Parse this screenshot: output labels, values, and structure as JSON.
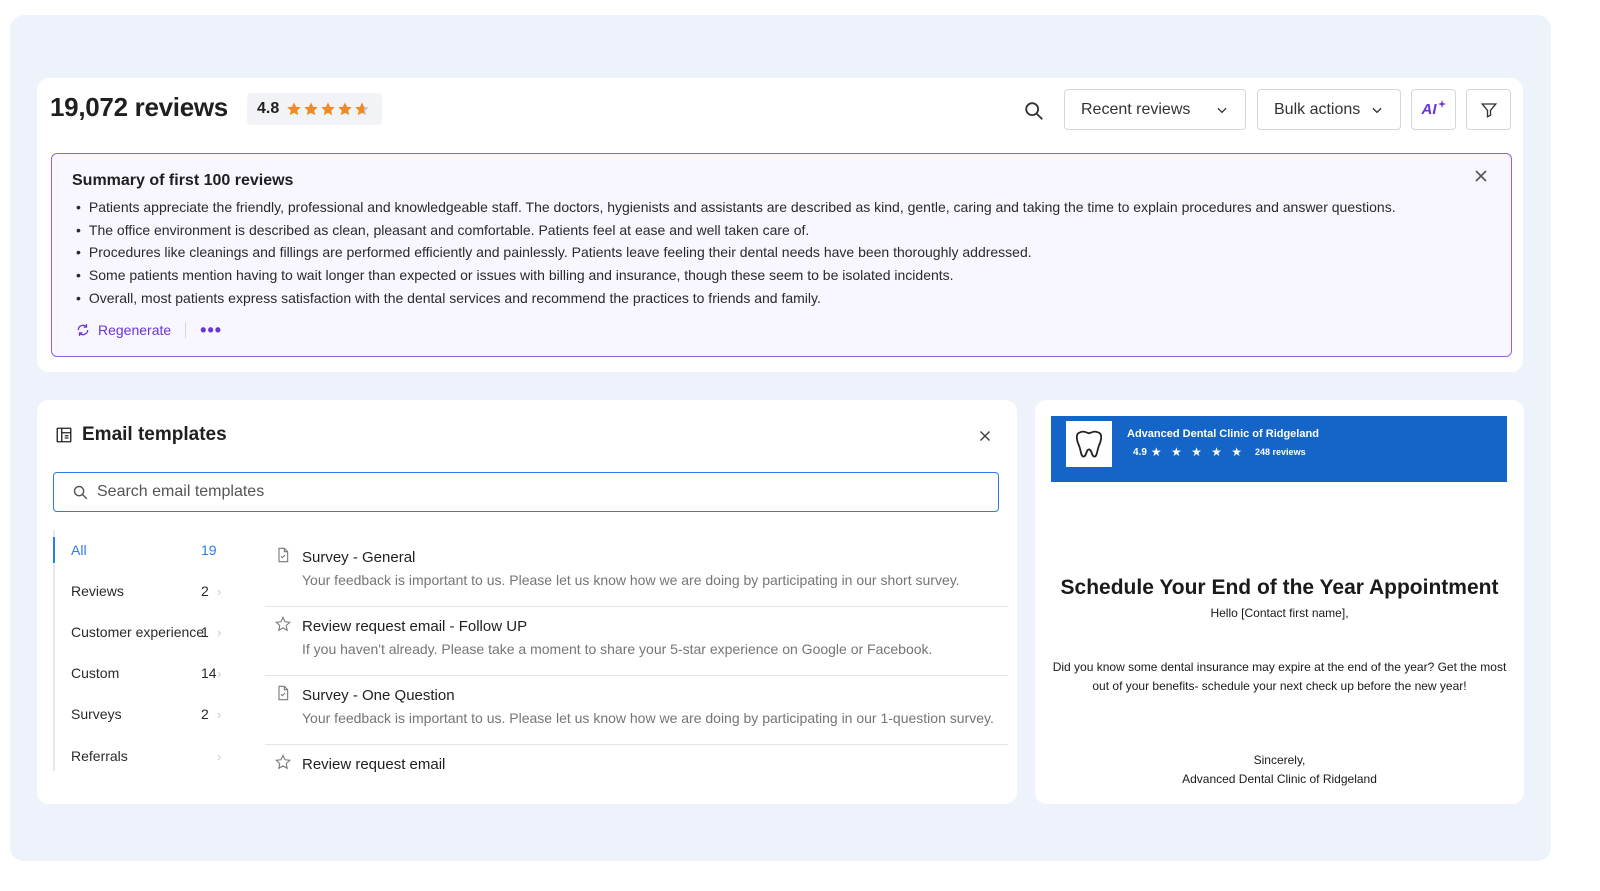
{
  "reviews": {
    "title": "19,072 reviews",
    "rating": "4.8",
    "rating_value": 4.8,
    "star_color": "#f08a24",
    "sort_dropdown": "Recent reviews",
    "bulk_dropdown": "Bulk actions",
    "ai_label": "AI"
  },
  "summary": {
    "title": "Summary of first 100 reviews",
    "points": [
      "Patients appreciate the friendly, professional and knowledgeable staff. The doctors, hygienists and assistants are described as kind, gentle, caring and taking the time to explain procedures and answer questions.",
      "The office environment is described as clean, pleasant and comfortable. Patients feel at ease and well taken care of.",
      "Procedures like cleanings and fillings are performed efficiently and painlessly. Patients leave feeling their dental needs have been thoroughly addressed.",
      "Some patients mention having to wait longer than expected or issues with billing and insurance, though these seem to be isolated incidents.",
      "Overall, most patients express satisfaction with the dental services and recommend the practices to friends and family."
    ],
    "regenerate_label": "Regenerate",
    "more_label": "•••",
    "accent_color": "#8f63e6"
  },
  "templates": {
    "title": "Email templates",
    "search_placeholder": "Search email templates",
    "categories": [
      {
        "label": "All",
        "count": "19"
      },
      {
        "label": "Reviews",
        "count": "2"
      },
      {
        "label": "Customer experience",
        "count": "1"
      },
      {
        "label": "Custom",
        "count": "14"
      },
      {
        "label": "Surveys",
        "count": "2"
      },
      {
        "label": "Referrals",
        "count": ""
      }
    ],
    "items": [
      {
        "name": "Survey - General",
        "desc": "Your feedback is important to us. Please let us know how we are doing by participating in our short survey.",
        "icon": "survey-doc-icon"
      },
      {
        "name": "Review request email - Follow UP",
        "desc": "If you haven't already. Please take a moment to share your 5-star experience on Google or Facebook.",
        "icon": "star-outline-icon"
      },
      {
        "name": "Survey - One Question",
        "desc": "Your feedback is important to us. Please let us know how we are doing by participating in our 1-question survey.",
        "icon": "survey-doc-icon"
      },
      {
        "name": "Review request email",
        "desc": "",
        "icon": "star-outline-icon"
      }
    ],
    "active_color": "#2f7be6"
  },
  "preview": {
    "business_name": "Advanced Dental Clinic of Ridgeland",
    "rating": "4.9",
    "stars": "★ ★ ★ ★ ★",
    "review_count": "248 reviews",
    "heading": "Schedule Your End of the Year Appointment",
    "greeting": "Hello [Contact first name],",
    "body": "Did you know some dental insurance may expire at the end of the year? Get the most out of your benefits- schedule your next check up before the new year!",
    "sign_off": "Sincerely,",
    "signature": "Advanced Dental Clinic of Ridgeland",
    "banner_color": "#1565c8"
  }
}
